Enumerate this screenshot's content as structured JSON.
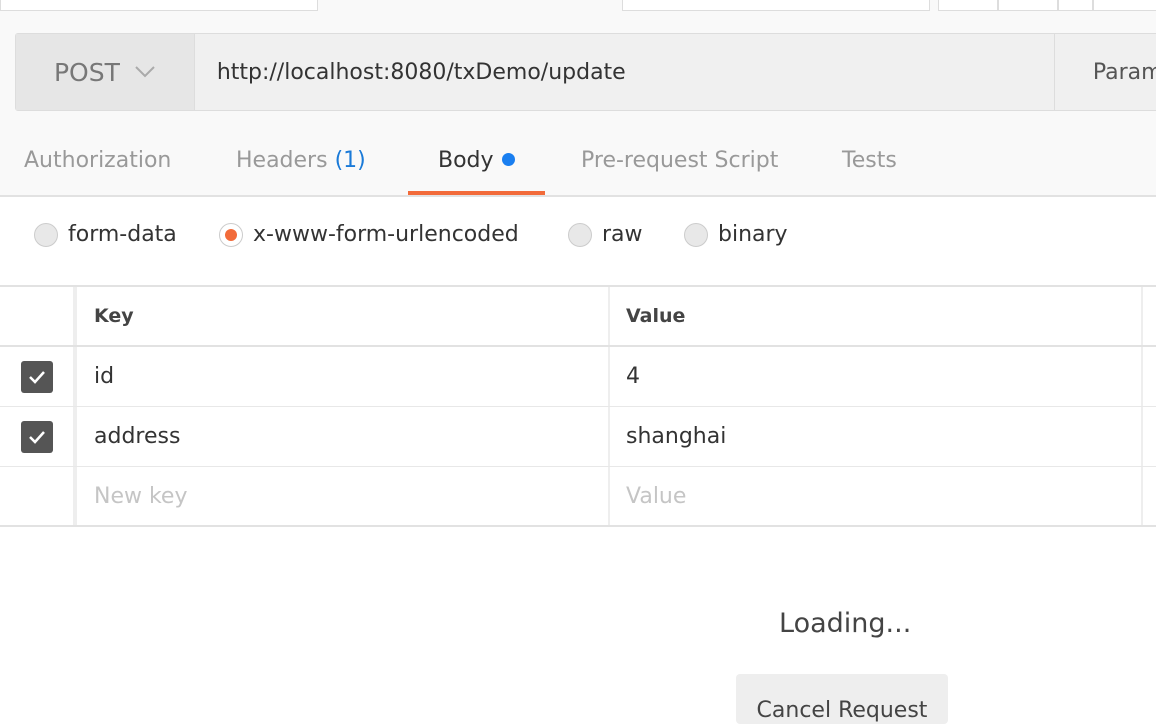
{
  "request": {
    "method": "POST",
    "url": "http://localhost:8080/txDemo/update",
    "params_label": "Params"
  },
  "tabs": [
    {
      "label": "Authorization"
    },
    {
      "label": "Headers",
      "count": "(1)"
    },
    {
      "label": "Body",
      "active": true
    },
    {
      "label": "Pre-request Script"
    },
    {
      "label": "Tests"
    }
  ],
  "body_modes": [
    {
      "label": "form-data",
      "selected": false
    },
    {
      "label": "x-www-form-urlencoded",
      "selected": true
    },
    {
      "label": "raw",
      "selected": false
    },
    {
      "label": "binary",
      "selected": false
    }
  ],
  "table": {
    "headers": {
      "key": "Key",
      "value": "Value"
    },
    "rows": [
      {
        "key": "id",
        "value": "4",
        "checked": true
      },
      {
        "key": "address",
        "value": "shanghai",
        "checked": true
      }
    ],
    "placeholder": {
      "key": "New key",
      "value": "Value"
    }
  },
  "response": {
    "loading": "Loading...",
    "cancel_label": "Cancel Request"
  },
  "colors": {
    "accent": "#f26b3a",
    "dot": "#1a7ff0"
  }
}
